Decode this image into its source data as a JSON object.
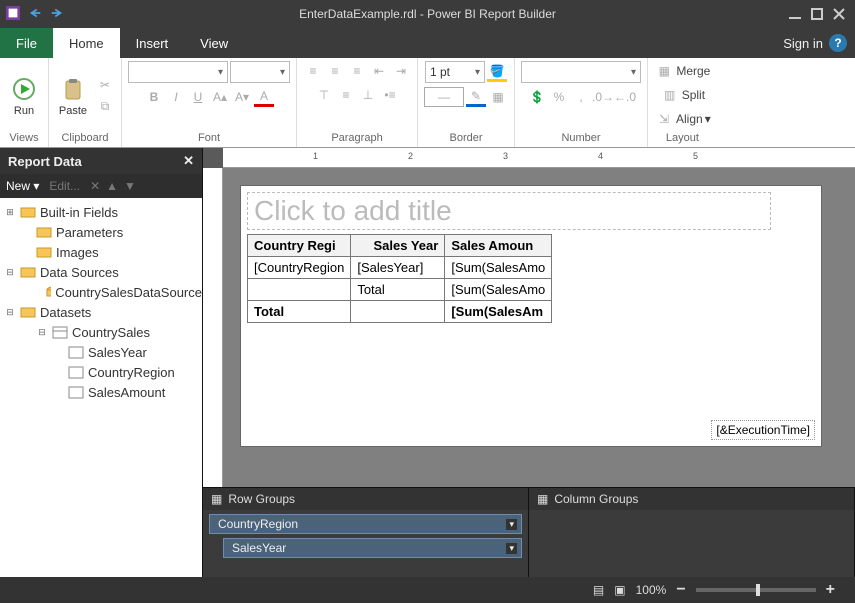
{
  "titlebar": {
    "filename": "EnterDataExample.rdl",
    "appname": "Power BI Report Builder"
  },
  "menu": {
    "file": "File",
    "home": "Home",
    "insert": "Insert",
    "view": "View",
    "signin": "Sign in"
  },
  "ribbon": {
    "views": {
      "run": "Run",
      "label": "Views"
    },
    "clipboard": {
      "paste": "Paste",
      "label": "Clipboard"
    },
    "font": {
      "label": "Font"
    },
    "paragraph": {
      "label": "Paragraph"
    },
    "border": {
      "width": "1 pt",
      "label": "Border"
    },
    "number": {
      "label": "Number"
    },
    "layout": {
      "merge": "Merge",
      "split": "Split",
      "align": "Align",
      "label": "Layout"
    }
  },
  "reportData": {
    "title": "Report Data",
    "new": "New",
    "edit": "Edit...",
    "tree": {
      "builtins": "Built-in Fields",
      "parameters": "Parameters",
      "images": "Images",
      "datasources": "Data Sources",
      "ds1": "CountrySalesDataSource",
      "datasets": "Datasets",
      "dset1": "CountrySales",
      "f1": "SalesYear",
      "f2": "CountryRegion",
      "f3": "SalesAmount"
    }
  },
  "design": {
    "titlePlaceholder": "Click to add title",
    "table": {
      "h1": "Country Regi",
      "h2": "Sales Year",
      "h3": "Sales Amoun",
      "r1c1": "[CountryRegion",
      "r1c2": "[SalesYear]",
      "r1c3": "[Sum(SalesAmo",
      "r2c1": "",
      "r2c2": "Total",
      "r2c3": "[Sum(SalesAmo",
      "r3c1": "Total",
      "r3c2": "",
      "r3c3": "[Sum(SalesAm"
    },
    "exec": "[&ExecutionTime]"
  },
  "groups": {
    "rowTitle": "Row Groups",
    "colTitle": "Column Groups",
    "g1": "CountryRegion",
    "g2": "SalesYear"
  },
  "status": {
    "zoom": "100%"
  }
}
